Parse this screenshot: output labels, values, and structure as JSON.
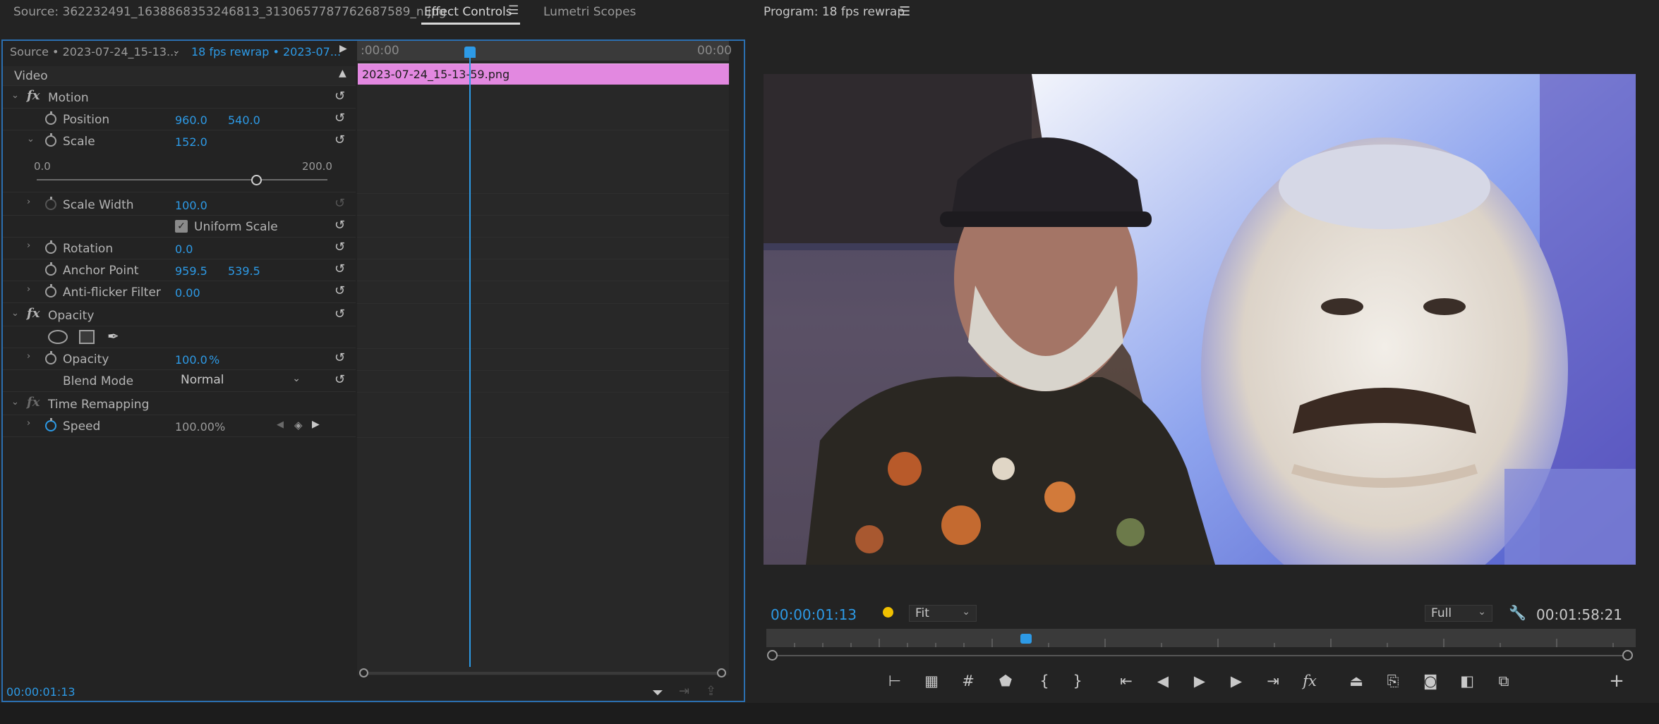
{
  "left_tabs": {
    "source": "Source: 362232491_1638868353246813_3130657787762687589_n.jpg",
    "effect_controls": "Effect Controls",
    "menu_icon": "hamburger-icon",
    "lumetri": "Lumetri Scopes"
  },
  "ec_header": {
    "source_label": "Source • 2023-07-24_15-13...",
    "sequence_label": "18 fps rewrap • 2023-07...",
    "timeline_start": ":00:00",
    "timeline_end": "00:00"
  },
  "clip": {
    "name": "2023-07-24_15-13-59.png"
  },
  "video_section": "Video",
  "motion": {
    "label": "Motion",
    "position": {
      "label": "Position",
      "x": "960.0",
      "y": "540.0"
    },
    "scale": {
      "label": "Scale",
      "value": "152.0",
      "slider_min": "0.0",
      "slider_max": "200.0",
      "slider_level": 0.76
    },
    "scale_width": {
      "label": "Scale Width",
      "value": "100.0"
    },
    "uniform_scale": {
      "label": "Uniform Scale",
      "checked": true
    },
    "rotation": {
      "label": "Rotation",
      "value": "0.0"
    },
    "anchor_point": {
      "label": "Anchor Point",
      "x": "959.5",
      "y": "539.5"
    },
    "anti_flicker": {
      "label": "Anti-flicker Filter",
      "value": "0.00"
    }
  },
  "opacity": {
    "label": "Opacity",
    "opacity": {
      "label": "Opacity",
      "value": "100.0",
      "unit": "%"
    },
    "blend_mode": {
      "label": "Blend Mode",
      "value": "Normal"
    }
  },
  "time_remapping": {
    "label": "Time Remapping",
    "speed": {
      "label": "Speed",
      "value": "100.00%"
    }
  },
  "left_footer": {
    "timecode": "00:00:01:13"
  },
  "program": {
    "title": "Program: 18 fps rewrap",
    "current_timecode": "00:00:01:13",
    "fit": "Fit",
    "quality": "Full",
    "duration": "00:01:58:21",
    "playhead_fraction": 0.3
  },
  "colors": {
    "accent_blue": "#2d9ae6",
    "clip_pink": "#e288e0",
    "marker_yellow": "#f0c000",
    "panel_bg": "#232323"
  }
}
